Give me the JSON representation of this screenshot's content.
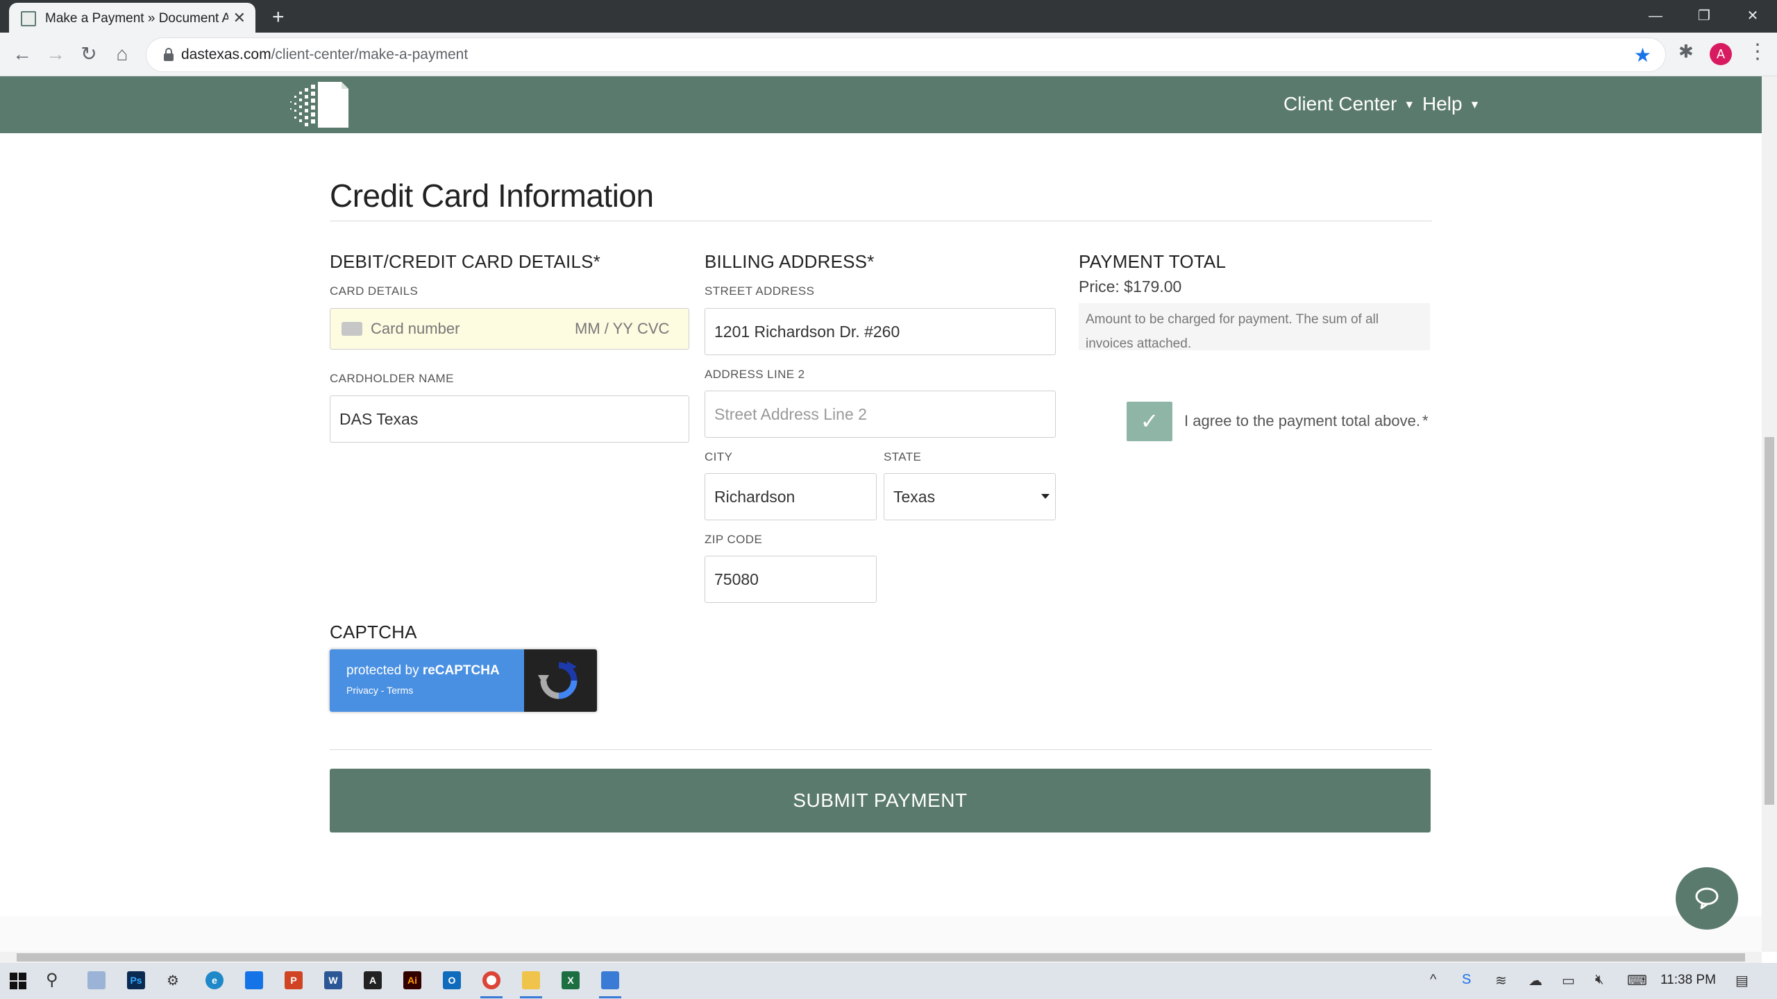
{
  "browser": {
    "tab_title": "Make a Payment » Document Ac",
    "url_host": "dastexas.com",
    "url_path": "/client-center/make-a-payment",
    "profile_initial": "A"
  },
  "nav": {
    "client_center": "Client Center",
    "help": "Help"
  },
  "page": {
    "section_title": "Credit Card Information"
  },
  "card": {
    "heading": "DEBIT/CREDIT CARD DETAILS*",
    "details_label": "CARD DETAILS",
    "number_placeholder": "Card number",
    "expiry_placeholder": "MM / YY",
    "cvc_placeholder": "CVC",
    "holder_label": "CARDHOLDER NAME",
    "holder_value": "DAS Texas"
  },
  "billing": {
    "heading": "BILLING ADDRESS*",
    "street_label": "STREET ADDRESS",
    "street_value": "1201 Richardson Dr. #260",
    "line2_label": "ADDRESS LINE 2",
    "line2_placeholder": "Street Address Line 2",
    "city_label": "CITY",
    "city_value": "Richardson",
    "state_label": "STATE",
    "state_value": "Texas",
    "zip_label": "ZIP CODE",
    "zip_value": "75080"
  },
  "payment": {
    "heading": "PAYMENT TOTAL",
    "price": "Price: $179.00",
    "note": "Amount to be charged for payment. The sum of all invoices attached.",
    "agree_label": "I agree to the payment total above.",
    "agree_required": "*",
    "agree_checked": true
  },
  "captcha": {
    "heading": "CAPTCHA",
    "protected_prefix": "protected by ",
    "brand": "reCAPTCHA",
    "links": "Privacy - Terms"
  },
  "submit_label": "SUBMIT PAYMENT",
  "taskbar": {
    "clock": "11:38 PM"
  },
  "colors": {
    "brand_green": "#5b7a6e",
    "checkbox_green": "#8fb5a7",
    "recaptcha_blue": "#4a90e2"
  }
}
